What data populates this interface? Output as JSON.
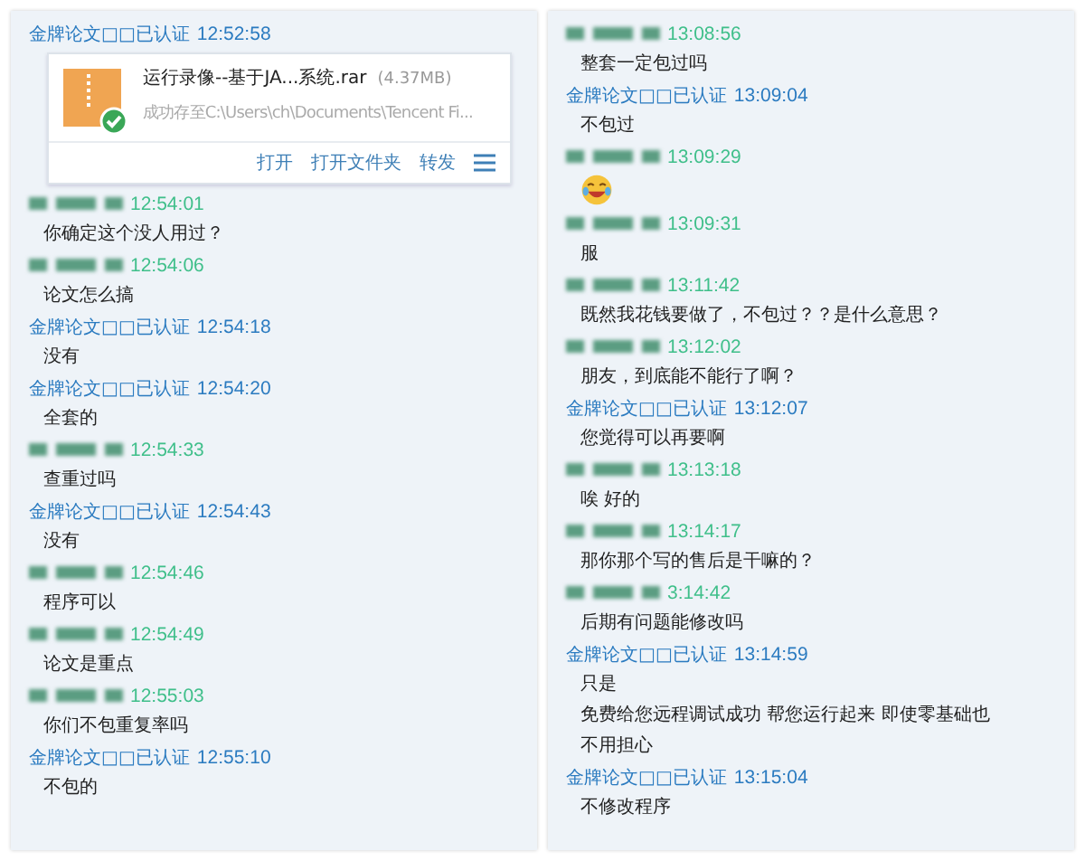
{
  "panels": [
    {
      "messages": [
        {
          "sender": {
            "kind": "verified",
            "name": "金牌论文□□已认证"
          },
          "time": "12:52:58",
          "body": [
            {
              "kind": "file",
              "name": "运行录像--基于JA...系统.rar",
              "size": "(4.37MB)",
              "status": "成功存至C:\\Users\\ch\\Documents\\Tencent Fi...",
              "actions": [
                "打开",
                "打开文件夹",
                "转发"
              ]
            }
          ]
        },
        {
          "sender": {
            "kind": "blurred"
          },
          "time": "12:54:01",
          "body": [
            {
              "kind": "text",
              "text": "你确定这个没人用过？"
            }
          ]
        },
        {
          "sender": {
            "kind": "blurred"
          },
          "time": "12:54:06",
          "body": [
            {
              "kind": "text",
              "text": "论文怎么搞"
            }
          ]
        },
        {
          "sender": {
            "kind": "verified",
            "name": "金牌论文□□已认证"
          },
          "time": "12:54:18",
          "body": [
            {
              "kind": "text",
              "text": "没有"
            }
          ]
        },
        {
          "sender": {
            "kind": "verified",
            "name": "金牌论文□□已认证"
          },
          "time": "12:54:20",
          "body": [
            {
              "kind": "text",
              "text": "全套的"
            }
          ]
        },
        {
          "sender": {
            "kind": "blurred"
          },
          "time": "12:54:33",
          "body": [
            {
              "kind": "text",
              "text": "查重过吗"
            }
          ]
        },
        {
          "sender": {
            "kind": "verified",
            "name": "金牌论文□□已认证"
          },
          "time": "12:54:43",
          "body": [
            {
              "kind": "text",
              "text": "没有"
            }
          ]
        },
        {
          "sender": {
            "kind": "blurred"
          },
          "time": "12:54:46",
          "body": [
            {
              "kind": "text",
              "text": "程序可以"
            }
          ]
        },
        {
          "sender": {
            "kind": "blurred"
          },
          "time": "12:54:49",
          "body": [
            {
              "kind": "text",
              "text": "论文是重点"
            }
          ]
        },
        {
          "sender": {
            "kind": "blurred"
          },
          "time": "12:55:03",
          "body": [
            {
              "kind": "text",
              "text": "你们不包重复率吗"
            }
          ]
        },
        {
          "sender": {
            "kind": "verified",
            "name": "金牌论文□□已认证"
          },
          "time": "12:55:10",
          "body": [
            {
              "kind": "text",
              "text": "不包的"
            }
          ]
        }
      ]
    },
    {
      "messages": [
        {
          "sender": {
            "kind": "blurred"
          },
          "time": "13:08:56",
          "body": [
            {
              "kind": "text",
              "text": "整套一定包过吗"
            }
          ]
        },
        {
          "sender": {
            "kind": "verified",
            "name": "金牌论文□□已认证"
          },
          "time": "13:09:04",
          "body": [
            {
              "kind": "text",
              "text": "不包过"
            }
          ]
        },
        {
          "sender": {
            "kind": "blurred"
          },
          "time": "13:09:29",
          "body": [
            {
              "kind": "emoji"
            }
          ]
        },
        {
          "sender": {
            "kind": "blurred"
          },
          "time": "13:09:31",
          "body": [
            {
              "kind": "text",
              "text": "服"
            }
          ]
        },
        {
          "sender": {
            "kind": "blurred"
          },
          "time": "13:11:42",
          "body": [
            {
              "kind": "text",
              "text": "既然我花钱要做了，不包过？？是什么意思？"
            }
          ]
        },
        {
          "sender": {
            "kind": "blurred"
          },
          "time": "13:12:02",
          "body": [
            {
              "kind": "text",
              "text": "朋友，到底能不能行了啊？"
            }
          ]
        },
        {
          "sender": {
            "kind": "verified",
            "name": "金牌论文□□已认证"
          },
          "time": "13:12:07",
          "body": [
            {
              "kind": "text",
              "text": "您觉得可以再要啊"
            }
          ]
        },
        {
          "sender": {
            "kind": "blurred"
          },
          "time": "13:13:18",
          "body": [
            {
              "kind": "text",
              "text": "唉 好的"
            }
          ]
        },
        {
          "sender": {
            "kind": "blurred"
          },
          "time": "13:14:17",
          "body": [
            {
              "kind": "text",
              "text": "那你那个写的售后是干嘛的？"
            }
          ]
        },
        {
          "sender": {
            "kind": "blurred"
          },
          "time": "3:14:42",
          "body": [
            {
              "kind": "text",
              "text": "后期有问题能修改吗"
            }
          ]
        },
        {
          "sender": {
            "kind": "verified",
            "name": "金牌论文□□已认证"
          },
          "time": "13:14:59",
          "body": [
            {
              "kind": "text",
              "text": "只是"
            },
            {
              "kind": "text",
              "text": "免费给您远程调试成功 帮您运行起来 即使零基础也"
            },
            {
              "kind": "text",
              "text": "不用担心"
            }
          ]
        },
        {
          "sender": {
            "kind": "verified",
            "name": "金牌论文□□已认证"
          },
          "time": "13:15:04",
          "body": [
            {
              "kind": "text",
              "text": "不修改程序"
            }
          ]
        }
      ]
    }
  ]
}
